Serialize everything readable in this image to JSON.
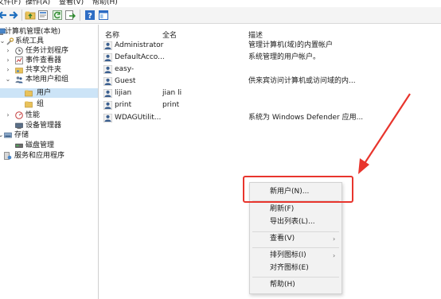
{
  "menubar": {
    "file": "文件(F)",
    "action": "操作(A)",
    "view": "查看(V)",
    "help": "帮助(H)"
  },
  "toolbar": {
    "buttons": [
      "back-icon",
      "forward-icon",
      "up-folder-icon",
      "properties-icon",
      "refresh-icon",
      "export-icon",
      "help-icon",
      "panel-icon"
    ]
  },
  "tree": {
    "root": "计算机管理(本地)",
    "system_tools": "系统工具",
    "task_scheduler": "任务计划程序",
    "event_viewer": "事件查看器",
    "shared_folders": "共享文件夹",
    "local_users": "本地用户和组",
    "users": "用户",
    "groups": "组",
    "performance": "性能",
    "device_manager": "设备管理器",
    "storage": "存储",
    "disk_management": "磁盘管理",
    "services": "服务和应用程序"
  },
  "list": {
    "headers": {
      "name": "名称",
      "fullname": "全名",
      "description": "描述"
    },
    "rows": [
      {
        "name": "Administrator",
        "fullname": "",
        "description": "管理计算机(域)的内置帐户"
      },
      {
        "name": "DefaultAcco...",
        "fullname": "",
        "description": "系统管理的用户帐户。"
      },
      {
        "name": "easy-",
        "fullname": "",
        "description": ""
      },
      {
        "name": "Guest",
        "fullname": "",
        "description": "供来宾访问计算机或访问域的内..."
      },
      {
        "name": "lijian",
        "fullname": "jian li",
        "description": ""
      },
      {
        "name": "print",
        "fullname": "print",
        "description": ""
      },
      {
        "name": "WDAGUtilit...",
        "fullname": "",
        "description": "系统为 Windows Defender 应用..."
      }
    ]
  },
  "context_menu": {
    "new_user": "新用户(N)...",
    "refresh": "刷新(F)",
    "export_list": "导出列表(L)...",
    "view": "查看(V)",
    "arrange_icons": "排列图标(I)",
    "align_icons": "对齐图标(E)",
    "help": "帮助(H)"
  },
  "colors": {
    "annotation": "#e8352d",
    "selection": "#cce4f7"
  }
}
